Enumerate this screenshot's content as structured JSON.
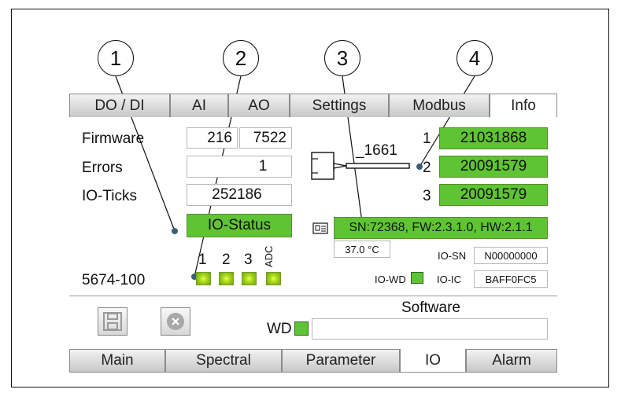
{
  "callouts": [
    "1",
    "2",
    "3",
    "4"
  ],
  "tabs": [
    {
      "label": "DO / DI",
      "active": false
    },
    {
      "label": "AI",
      "active": false
    },
    {
      "label": "AO",
      "active": false
    },
    {
      "label": "Settings",
      "active": false
    },
    {
      "label": "Modbus",
      "active": false
    },
    {
      "label": "Info",
      "active": true
    }
  ],
  "info": {
    "firmware_label": "Firmware",
    "firmware_major": "216",
    "firmware_minor": "7522",
    "errors_label": "Errors",
    "errors_value": "1",
    "ioticks_label": "IO-Ticks",
    "ioticks_value": "252186",
    "io_status": "IO-Status",
    "led_labels": [
      "1",
      "2",
      "3",
      "ADC"
    ],
    "device_id": "5674-100"
  },
  "sensor": {
    "cable_label": "_1661",
    "channels": [
      {
        "num": "1",
        "sn": "21031868"
      },
      {
        "num": "2",
        "sn": "20091579"
      },
      {
        "num": "3",
        "sn": "20091579"
      }
    ],
    "module_info": "SN:72368, FW:2.3.1.0, HW:2.1.1",
    "temperature": "37.0 °C",
    "io_sn_label": "IO-SN",
    "io_sn_value": "N00000000",
    "io_wd_label": "IO-WD",
    "io_ic_label": "IO-IC",
    "io_ic_value": "BAFF0FC5"
  },
  "software": {
    "title": "Software",
    "wd_label": "WD",
    "wd_field": ""
  },
  "bottom_tabs": [
    {
      "label": "Main",
      "active": false
    },
    {
      "label": "Spectral",
      "active": false
    },
    {
      "label": "Parameter",
      "active": false
    },
    {
      "label": "IO",
      "active": true
    },
    {
      "label": "Alarm",
      "active": false
    }
  ],
  "colors": {
    "status_green": "#5fc434",
    "led_green": "#a9d81e"
  }
}
